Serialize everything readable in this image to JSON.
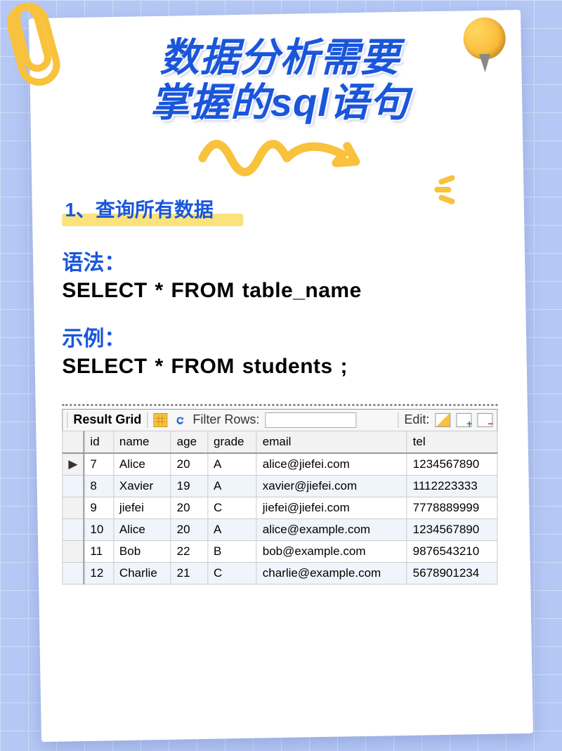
{
  "title_line1": "数据分析需要",
  "title_line2": "掌握的sql语句",
  "section_number": "1、",
  "section_title": "查询所有数据",
  "syntax_label": "语法：",
  "syntax_code": "SELECT * FROM table_name",
  "example_label": "示例：",
  "example_code": "SELECT * FROM students ;",
  "toolbar": {
    "result_grid": "Result Grid",
    "filter_label": "Filter Rows:",
    "filter_value": "",
    "edit_label": "Edit:"
  },
  "columns": [
    "id",
    "name",
    "age",
    "grade",
    "email",
    "tel"
  ],
  "rows": [
    {
      "_ptr": "▶",
      "id": "7",
      "name": "Alice",
      "age": "20",
      "grade": "A",
      "email": "alice@jiefei.com",
      "tel": "1234567890"
    },
    {
      "_ptr": "",
      "id": "8",
      "name": "Xavier",
      "age": "19",
      "grade": "A",
      "email": "xavier@jiefei.com",
      "tel": "1112223333"
    },
    {
      "_ptr": "",
      "id": "9",
      "name": "jiefei",
      "age": "20",
      "grade": "C",
      "email": "jiefei@jiefei.com",
      "tel": "7778889999"
    },
    {
      "_ptr": "",
      "id": "10",
      "name": "Alice",
      "age": "20",
      "grade": "A",
      "email": "alice@example.com",
      "tel": "1234567890"
    },
    {
      "_ptr": "",
      "id": "11",
      "name": "Bob",
      "age": "22",
      "grade": "B",
      "email": "bob@example.com",
      "tel": "9876543210"
    },
    {
      "_ptr": "",
      "id": "12",
      "name": "Charlie",
      "age": "21",
      "grade": "C",
      "email": "charlie@example.com",
      "tel": "5678901234"
    }
  ]
}
